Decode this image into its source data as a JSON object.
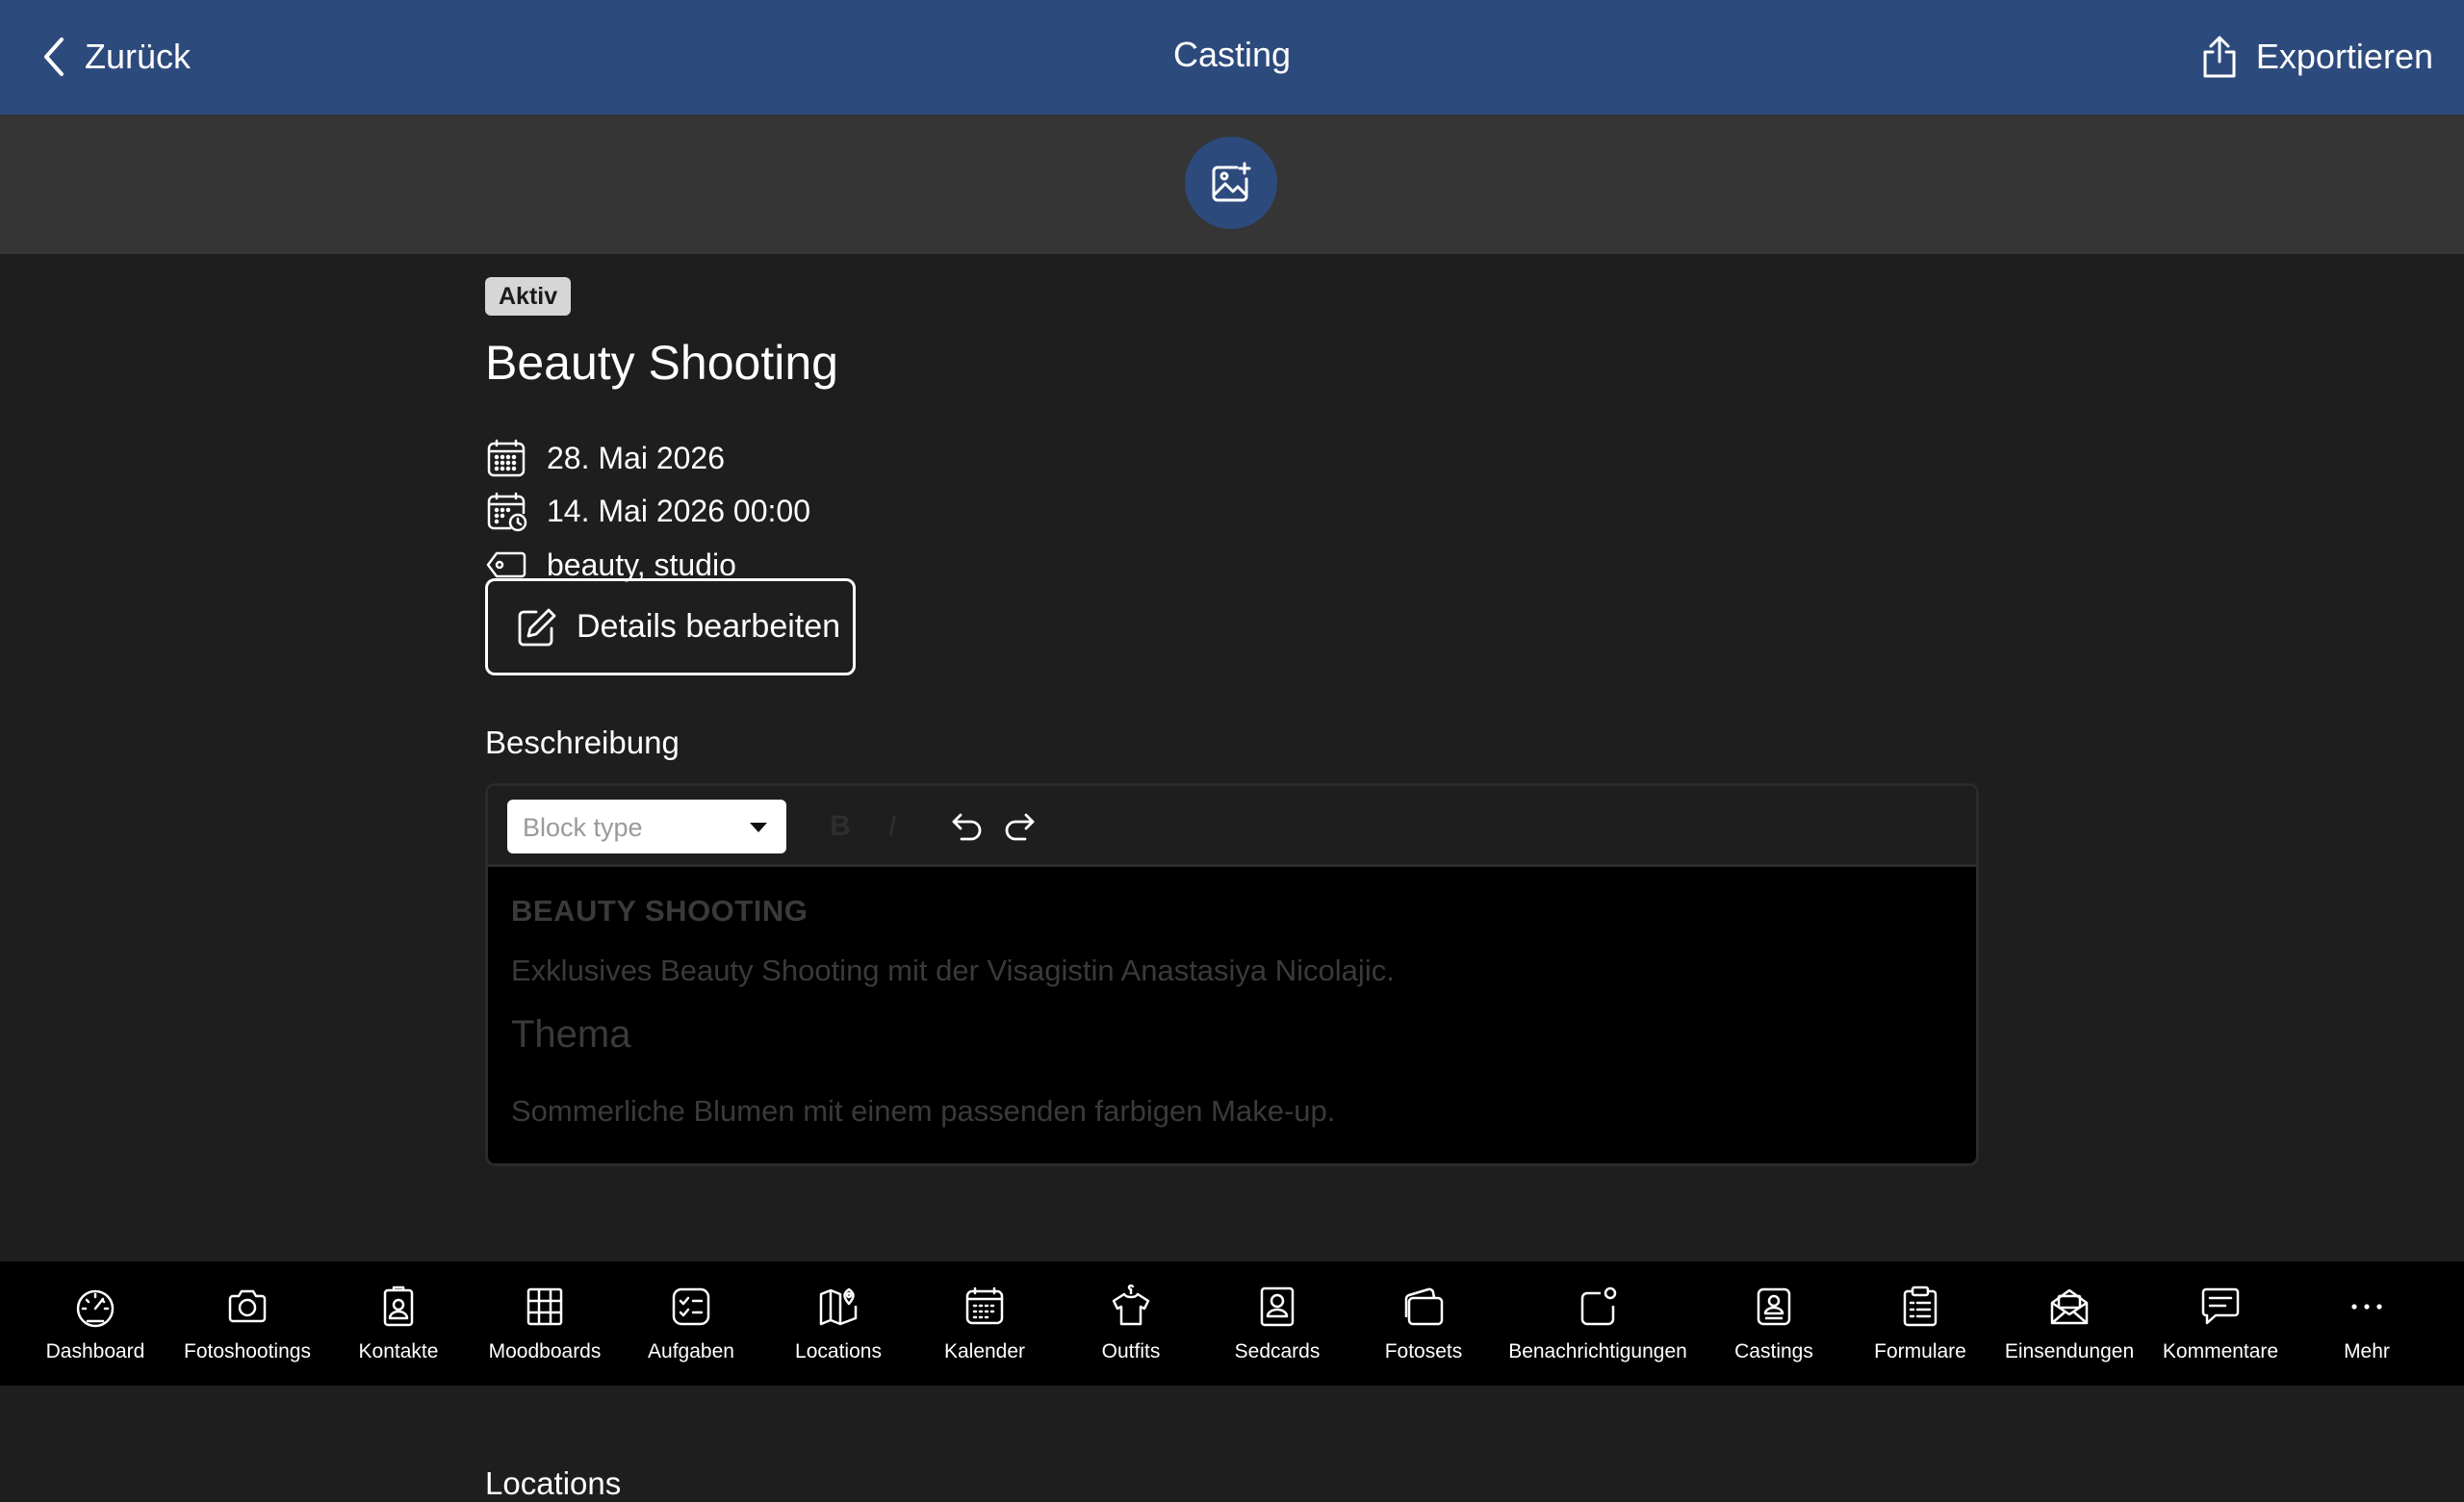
{
  "header": {
    "back_label": "Zurück",
    "title": "Casting",
    "export_label": "Exportieren",
    "background": "#2d4a7c"
  },
  "cover": {
    "icon": "image-add-icon"
  },
  "casting": {
    "status": "Aktiv",
    "title": "Beauty Shooting",
    "date": "28. Mai 2026",
    "deadline": "14. Mai 2026 00:00",
    "tags": "beauty, studio",
    "edit_label": "Details bearbeiten"
  },
  "description": {
    "heading": "Beschreibung",
    "toolbar": {
      "block_type_placeholder": "Block type",
      "bold": "B",
      "italic": "I"
    },
    "content": {
      "heading1": "BEAUTY SHOOTING",
      "paragraph1": "Exklusives Beauty Shooting mit der Visagistin Anastasiya Nicolajic.",
      "heading2": "Thema",
      "paragraph2": "Sommerliche Blumen mit einem passenden farbigen Make-up."
    }
  },
  "locations": {
    "heading": "Locations"
  },
  "tabbar": {
    "items": [
      {
        "label": "Dashboard",
        "icon": "gauge-icon"
      },
      {
        "label": "Fotoshootings",
        "icon": "camera-icon"
      },
      {
        "label": "Kontakte",
        "icon": "contact-card-icon"
      },
      {
        "label": "Moodboards",
        "icon": "grid-board-icon"
      },
      {
        "label": "Aufgaben",
        "icon": "checklist-icon"
      },
      {
        "label": "Locations",
        "icon": "map-pin-icon"
      },
      {
        "label": "Kalender",
        "icon": "calendar-icon"
      },
      {
        "label": "Outfits",
        "icon": "shirt-icon"
      },
      {
        "label": "Sedcards",
        "icon": "sedcard-icon"
      },
      {
        "label": "Fotosets",
        "icon": "photo-stack-icon"
      },
      {
        "label": "Benachrichtigungen",
        "icon": "notification-icon"
      },
      {
        "label": "Castings",
        "icon": "casting-icon"
      },
      {
        "label": "Formulare",
        "icon": "clipboard-icon"
      },
      {
        "label": "Einsendungen",
        "icon": "mail-icon"
      },
      {
        "label": "Kommentare",
        "icon": "comment-icon"
      },
      {
        "label": "Mehr",
        "icon": "more-icon"
      }
    ]
  }
}
